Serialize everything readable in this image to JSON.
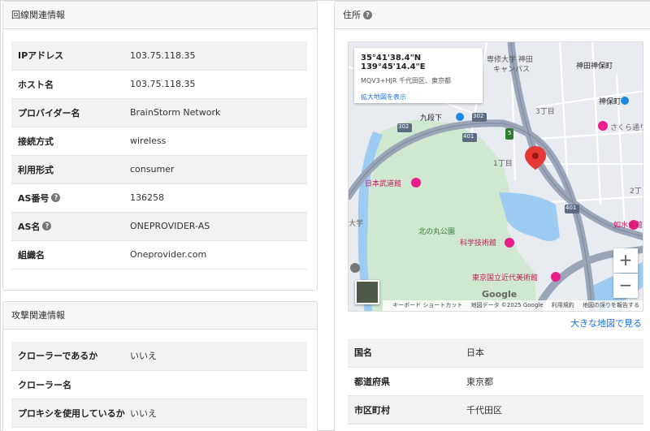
{
  "line_info": {
    "title": "回線関連情報",
    "rows": [
      {
        "key": "IPアドレス",
        "value": "103.75.118.35",
        "help": false
      },
      {
        "key": "ホスト名",
        "value": "103.75.118.35",
        "help": false
      },
      {
        "key": "プロバイダー名",
        "value": "BrainStorm Network",
        "help": false
      },
      {
        "key": "接続方式",
        "value": "wireless",
        "help": false
      },
      {
        "key": "利用形式",
        "value": "consumer",
        "help": false
      },
      {
        "key": "AS番号",
        "value": "136258",
        "help": true
      },
      {
        "key": "AS名",
        "value": "ONEPROVIDER-AS",
        "help": true
      },
      {
        "key": "組織名",
        "value": "Oneprovider.com",
        "help": false
      }
    ]
  },
  "attack_info": {
    "title": "攻撃関連情報",
    "rows": [
      {
        "key": "クローラーであるか",
        "value": "いいえ"
      },
      {
        "key": "クローラー名",
        "value": ""
      },
      {
        "key": "プロキシを使用しているか",
        "value": "いいえ"
      }
    ]
  },
  "address": {
    "title": "住所",
    "help_glyph": "?",
    "map": {
      "coord": "35°41'38.4\"N 139°45'14.4\"E",
      "plus_code": "MQV3+HJR 千代田区、東京都",
      "enlarge_link": "拡大地図を表示",
      "zoom_in": "+",
      "zoom_out": "−",
      "google": "Google",
      "attribution": [
        "キーボード ショートカット",
        "地図データ ©2025 Google",
        "利用規約",
        "地図の誤りを報告する"
      ],
      "labels": {
        "budokan": "日本武道館",
        "kitanomaru": "北の丸公園",
        "kagaku": "科学技術館",
        "kindai": "東京国立近代美術館",
        "kudanshita": "九段下",
        "jinbocho": "神田神保町",
        "jinbocho_stn": "神保町",
        "chome3": "3丁目",
        "chome1": "1丁目",
        "chome2": "2丁",
        "sakura": "さくら通り",
        "nyoshui": "如水会館",
        "univ": "大学",
        "senshu": "専修大学 神田",
        "campus": "キャンパス",
        "r302a": "302",
        "r302b": "302",
        "r401a": "401",
        "r401b": "401",
        "r5": "5"
      }
    },
    "big_map_link": "大きな地図で見る",
    "rows": [
      {
        "key": "国名",
        "value": "日本"
      },
      {
        "key": "都道府県",
        "value": "東京都"
      },
      {
        "key": "市区町村",
        "value": "千代田区"
      }
    ]
  },
  "colors": {
    "pin": "#e53935",
    "expressway": "#9aa6b8",
    "park": "#cfe8cf",
    "water": "#9ecbf2",
    "link": "#1a73e8"
  }
}
